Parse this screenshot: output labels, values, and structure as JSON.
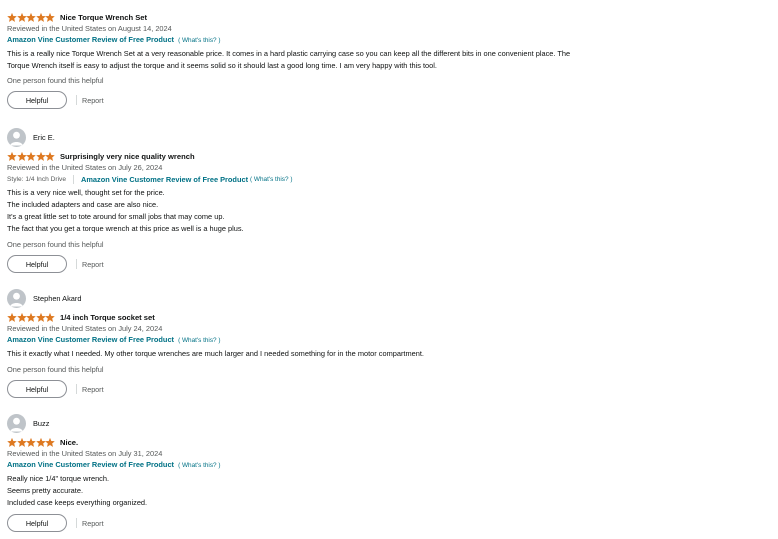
{
  "colors": {
    "star": "#de7921",
    "link": "#007185",
    "meta": "#565959"
  },
  "reviews": [
    {
      "reviewer": "",
      "rating": 5,
      "title": "Nice Torque Wrench Set",
      "date": "Reviewed in the United States on August 14, 2024",
      "style": "",
      "vine": "Amazon Vine Customer Review of Free Product",
      "whats_this": "( What's this? )",
      "body": [
        "This is a really nice Torque Wrench Set at a very reasonable price. It comes in a hard plastic carrying case so you can keep all the different bits in one convenient place. The",
        "Torque Wrench itself is easy to adjust the torque and it seems solid so it should last a good long time. I am very happy with this tool."
      ],
      "found_helpful": "One person found this helpful",
      "helpful_label": "Helpful",
      "report_label": "Report"
    },
    {
      "reviewer": "Eric E.",
      "rating": 5,
      "title": "Surprisingly very nice quality wrench",
      "date": "Reviewed in the United States on July 26, 2024",
      "style": "Style: 1/4 Inch Drive",
      "vine": "Amazon Vine Customer Review of Free Product",
      "whats_this": "( What's this? )",
      "body": [
        "This is a very nice well, thought set for the price.",
        "The included adapters and case are also nice.",
        "It's a great little set to tote around for small jobs that may come up.",
        "The fact that you get a torque wrench at this price as well is a huge plus."
      ],
      "found_helpful": "One person found this helpful",
      "helpful_label": "Helpful",
      "report_label": "Report"
    },
    {
      "reviewer": "Stephen Akard",
      "rating": 5,
      "title": "1/4 inch Torque socket set",
      "date": "Reviewed in the United States on July 24, 2024",
      "style": "",
      "vine": "Amazon Vine Customer Review of Free Product",
      "whats_this": "( What's this? )",
      "body": [
        "This it exactly what I needed. My other torque wrenches are much larger and I needed something for in the motor compartment."
      ],
      "found_helpful": "One person found this helpful",
      "helpful_label": "Helpful",
      "report_label": "Report"
    },
    {
      "reviewer": "Buzz",
      "rating": 5,
      "title": "Nice.",
      "date": "Reviewed in the United States on July 31, 2024",
      "style": "",
      "vine": "Amazon Vine Customer Review of Free Product",
      "whats_this": "( What's this? )",
      "body": [
        "Really nice 1/4\" torque wrench.",
        "Seems pretty accurate.",
        "Included case keeps everything organized."
      ],
      "found_helpful": "",
      "helpful_label": "Helpful",
      "report_label": "Report"
    }
  ]
}
